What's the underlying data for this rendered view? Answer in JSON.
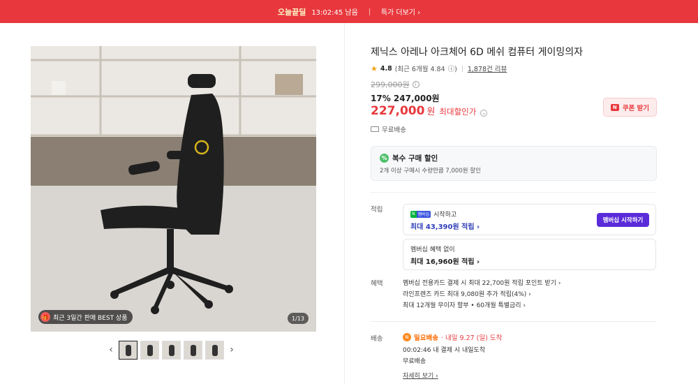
{
  "topbar": {
    "deal_label": "오늘끝딜",
    "timer": "13:02:45 남음",
    "more_label": "특가 더보기 ›"
  },
  "gallery": {
    "badge_icon": "gift-icon",
    "badge_text": "최근 3일간 판매 BEST 상품",
    "counter": "1/13",
    "prev_label": "‹",
    "next_label": "›",
    "thumbnail_count": 5
  },
  "product": {
    "title": "제닉스 아레나 아크체어 6D 메쉬 컴퓨터 게이밍의자",
    "rating_score": "4.8",
    "rating_recent": "(최근 6개월 4.84",
    "rating_info": "ⓘ)",
    "reviews": "1,878건 리뷰",
    "original_price": "299,000원",
    "sale_line": "17% 247,000원",
    "final_price": "227,000",
    "final_unit": "원",
    "final_label": "최대할인가",
    "chevron": "⌄",
    "coupon_label": "쿠폰 받기",
    "coupon_logo": "N",
    "shipping": "무료배송"
  },
  "multi_discount": {
    "icon_text": "%",
    "title": "복수 구매 할인",
    "desc": "2개 이상 구매시 수량만큼 7,000원 할인"
  },
  "points": {
    "label": "적립",
    "member_logo_a": "N",
    "member_logo_b": "멤버십",
    "member_start_text": "시작하고",
    "member_max": "최대 43,390원 적립 ›",
    "member_button": "멤버십 시작하기",
    "nonmember_text": "멤버십 혜택 없이",
    "nonmember_max": "최대 16,960원 적립 ›"
  },
  "benefits": {
    "label": "혜택",
    "items": [
      "멤버십 전용카드 결제 시 최대 22,700원 적립 포인트 받기 ›",
      "라인프렌즈 카드 최대 9,080원 추가 적립(4%) ›",
      "최대 12개월 무이자 할부 • 60개월 특별금리 ›"
    ]
  },
  "delivery": {
    "label": "배송",
    "badge": "N",
    "type": "밀요배송",
    "eta": "· 내일 9.27 (일) 도착",
    "cutoff": "00:02:46  내 결제 시 내일도착",
    "free": "무료배송",
    "more": "자세히 보기 ›"
  },
  "colors": {
    "accent_red": "#e8383d",
    "member_purple": "#5a2bd9",
    "point_blue": "#2f3fb8"
  }
}
